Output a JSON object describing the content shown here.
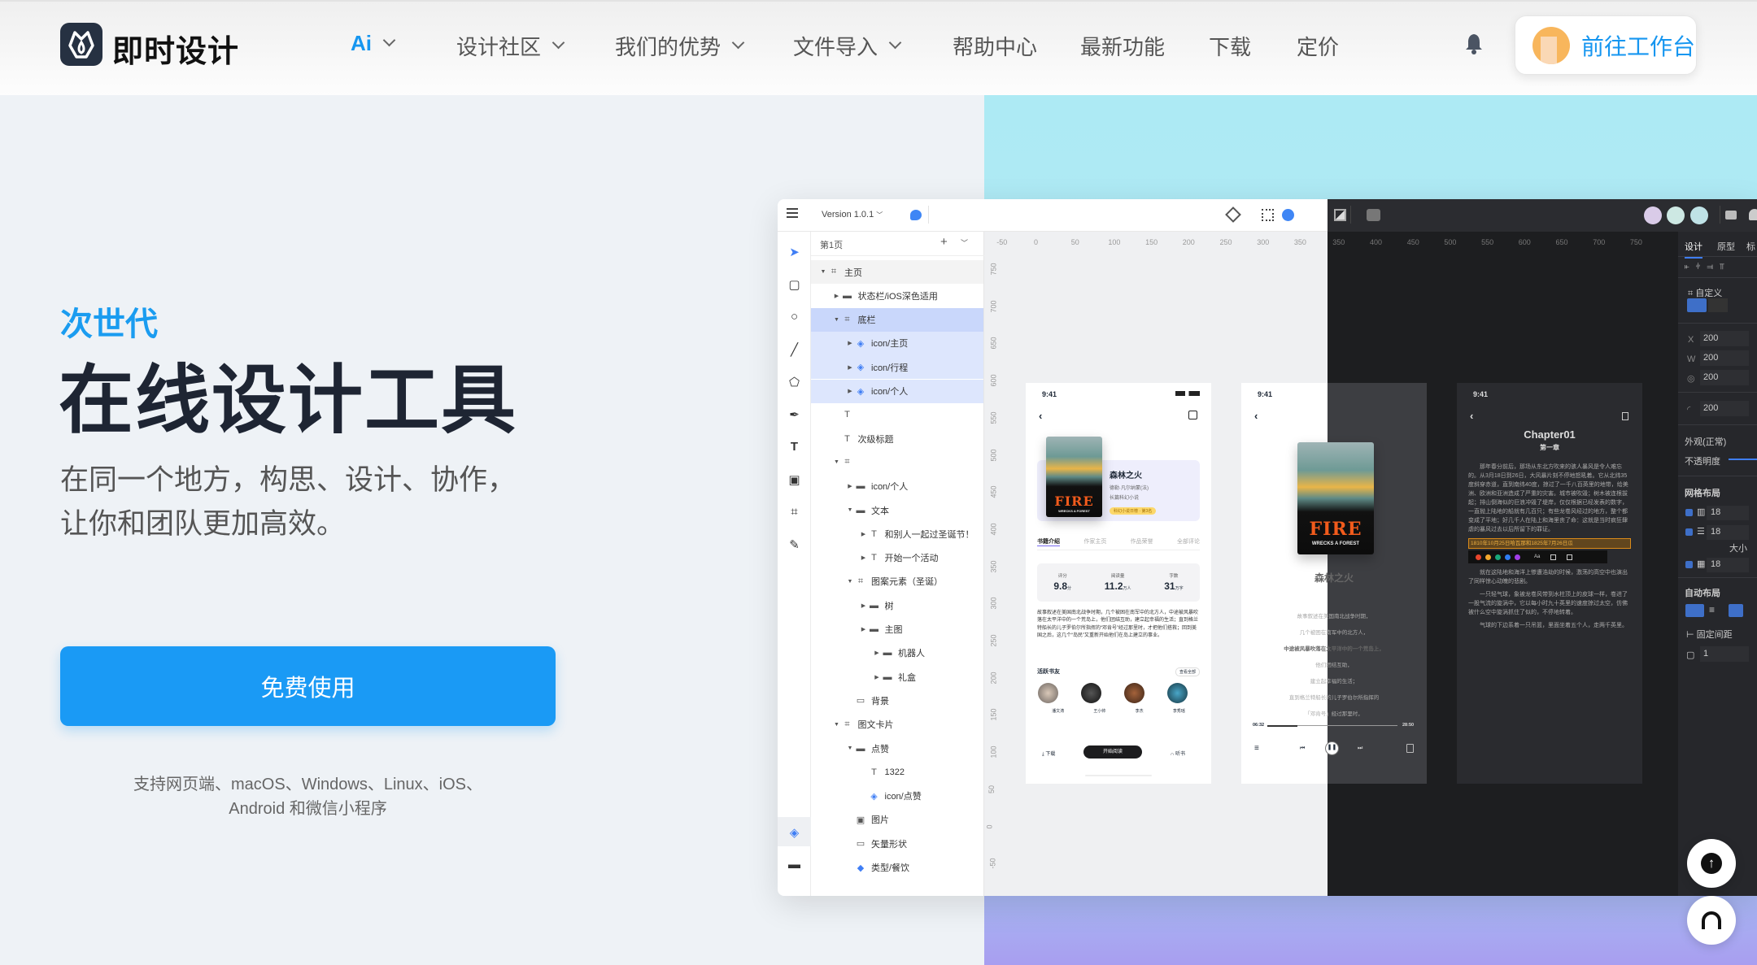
{
  "header": {
    "logo_text": "即时设计",
    "nav": [
      {
        "label": "Ai",
        "dropdown": true,
        "active": true
      },
      {
        "label": "设计社区",
        "dropdown": true
      },
      {
        "label": "我们的优势",
        "dropdown": true
      },
      {
        "label": "文件导入",
        "dropdown": true
      },
      {
        "label": "帮助中心",
        "dropdown": false
      },
      {
        "label": "最新功能",
        "dropdown": false
      },
      {
        "label": "下载",
        "dropdown": false
      },
      {
        "label": "定价",
        "dropdown": false
      }
    ],
    "bell_icon": "bell-icon",
    "workspace_button": "前往工作台"
  },
  "hero": {
    "kicker": "次世代",
    "title": "在线设计工具",
    "subtitle_lines": [
      "在同一个地方，构思、设计、协作，",
      "让你和团队更加高效。"
    ],
    "cta": "免费使用",
    "support_lines": [
      "支持网页端、macOS、Windows、Linux、iOS、",
      "Android 和微信小程序"
    ]
  },
  "colors": {
    "accent": "#1a9af5",
    "kicker": "#1a9cf0",
    "dark_canvas": "#1d1e20",
    "selected_layer": "#c9d7fb"
  },
  "app": {
    "version": "Version 1.0.1",
    "page": "第1页",
    "layers": [
      {
        "label": "主页",
        "type": "frame",
        "level": 0,
        "arrow": "down",
        "state": "hover"
      },
      {
        "label": "状态栏/iOS深色适用",
        "type": "folder",
        "level": 1,
        "arrow": "right"
      },
      {
        "label": "底栏",
        "type": "frame",
        "level": 1,
        "arrow": "down",
        "state": "selected"
      },
      {
        "label": "icon/主页",
        "type": "component",
        "level": 2,
        "arrow": "right",
        "state": "child"
      },
      {
        "label": "icon/行程",
        "type": "component",
        "level": 2,
        "arrow": "right",
        "state": "child"
      },
      {
        "label": "icon/个人",
        "type": "component",
        "level": 2,
        "arrow": "right",
        "state": "child"
      },
      {
        "label": "",
        "type": "text",
        "level": 1,
        "arrow": ""
      },
      {
        "label": "次级标题",
        "type": "text",
        "level": 1,
        "arrow": ""
      },
      {
        "label": "",
        "type": "frame",
        "level": 1,
        "arrow": "down"
      },
      {
        "label": "icon/个人",
        "type": "folder",
        "level": 2,
        "arrow": "right"
      },
      {
        "label": "文本",
        "type": "folder",
        "level": 2,
        "arrow": "down"
      },
      {
        "label": "和别人一起过圣诞节！",
        "type": "text",
        "level": 3,
        "arrow": "right"
      },
      {
        "label": "开始一个活动",
        "type": "text",
        "level": 3,
        "arrow": "right"
      },
      {
        "label": "图案元素（圣诞）",
        "type": "frame",
        "level": 2,
        "arrow": "down"
      },
      {
        "label": "树",
        "type": "folder",
        "level": 3,
        "arrow": "right"
      },
      {
        "label": "主图",
        "type": "folder",
        "level": 3,
        "arrow": "right"
      },
      {
        "label": "机器人",
        "type": "folder",
        "level": 4,
        "arrow": "right"
      },
      {
        "label": "礼盒",
        "type": "folder",
        "level": 4,
        "arrow": "right"
      },
      {
        "label": "背景",
        "type": "rect",
        "level": 2,
        "arrow": ""
      },
      {
        "label": "图文卡片",
        "type": "frame",
        "level": 1,
        "arrow": "down"
      },
      {
        "label": "点赞",
        "type": "folder",
        "level": 2,
        "arrow": "down"
      },
      {
        "label": "1322",
        "type": "text",
        "level": 3,
        "arrow": ""
      },
      {
        "label": "icon/点赞",
        "type": "component",
        "level": 3,
        "arrow": ""
      },
      {
        "label": "图片",
        "type": "image",
        "level": 2,
        "arrow": ""
      },
      {
        "label": "矢量形状",
        "type": "rect",
        "level": 2,
        "arrow": ""
      },
      {
        "label": "类型/餐饮",
        "type": "main-component",
        "level": 2,
        "arrow": ""
      }
    ],
    "ruler_top_light": [
      "-50",
      "0",
      "50",
      "100",
      "150",
      "200",
      "250",
      "300",
      "350"
    ],
    "ruler_top_dark": [
      "350",
      "400",
      "450",
      "500",
      "550",
      "600",
      "650",
      "700",
      "750"
    ],
    "ruler_left": [
      "750",
      "700",
      "650",
      "600",
      "550",
      "500",
      "450",
      "400",
      "350",
      "300",
      "250",
      "200",
      "150",
      "100",
      "50",
      "0",
      "-50"
    ],
    "phone1": {
      "time": "9:41",
      "book_title": "森林之火",
      "author": "德勒·凡尔纳蒙(法)",
      "genre": "长篇科幻小说",
      "badge": "科幻小说日榜 · 第3名",
      "cover_title": "FIRE",
      "cover_sub": "WRECKS A FOREST",
      "tabs": [
        "书籍介绍",
        "作家主页",
        "作品荣誉",
        "全部评论"
      ],
      "stats": [
        {
          "label": "评分",
          "value": "9.8",
          "unit": "分"
        },
        {
          "label": "阅读量",
          "value": "11.2",
          "unit": "万人"
        },
        {
          "label": "字数",
          "value": "31",
          "unit": "万字"
        }
      ],
      "description": "故事叙述在美国南北战争时期，几个被困在南军中的北方人，中途被风暴吹落在太平洋中的一个荒岛上，他们团结互助，建立起幸福的生活；直到格兰特船长的儿子罗伯尔所指挥的“邓肯号”经过那里时，才把他们搭救；回到美国之后，这几个“岛民”又重新开始他们在岛上建立的事业。",
      "friends_title": "活跃书友",
      "view_all": "查看全部",
      "friends": [
        "潘文涛",
        "王小帅",
        "李杰",
        "李秀瑶"
      ],
      "download": "下载",
      "start_reading": "开始阅读",
      "listen": "听书"
    },
    "phone2": {
      "time": "9:41",
      "book_title": "森林之火",
      "lyrics": [
        "故事叙述在美国南北战争时期，",
        "几个被困在南军中的北方人，",
        "中途被风暴吹落在太平洋中的一个荒岛上，",
        "他们团结互助，",
        "建立起幸福的生活；",
        "直到格兰特船长的儿子罗伯尔所指挥的",
        "「邓肯号」经过那里时，"
      ],
      "current_lyric_index": 2,
      "elapsed": "06:32",
      "total": "28:50",
      "progress": 0.23
    },
    "phone3": {
      "time": "9:41",
      "chapter": "Chapter01",
      "chapter_cn": "第一章",
      "paragraphs": [
        "那年春分前后，那场从东北方吹来的骇人暴风是令人难忘的。从3月18日到26日，大风暴片刻不停地怒吼着。它从北纬35度斜穿赤道，直到南纬40度，掠过了一千八百英里的地带，给美洲、欧洲和亚洲造成了严重的灾害。城市被吹毁；树木被连根拔起；排山倒海似的巨浪冲毁了堤岸，仅仅根据已经发表的数字，一直抛上陆地的船就有几百只；有些龙卷风经过的地方，整个都变成了平地；好几千人在陆上和海里丧了命：这就是当时疯狂肆虐的暴风过去以后所留下的罪证。",
        "就在这陆地和海洋上惨遭浩劫的时候，激荡的高空中也演出了同样惊心动魄的悲剧。",
        "一只轻气球，象被龙卷风带到水柱顶上的皮球一样，卷进了一股气流的旋涡中，它以每小时九十英里的速度掠过太空，仿佛被什么空中旋涡抓住了似的，不停地转着。",
        "气球的下边系着一只吊篮，里面坐着五个人，走两千英里。"
      ],
      "highlight": "1810年10月25日哈瓦那和1825年7月26日瓜",
      "highlight_colors": [
        "#e8452c",
        "#f2a72c",
        "#18a87a",
        "#2f7df2",
        "#a23ee8"
      ],
      "font_label": "Aa"
    },
    "right_panel": {
      "tabs": [
        "设计",
        "原型",
        "标"
      ],
      "preset": "自定义",
      "x_label": "X",
      "x": "200",
      "w_label": "W",
      "w": "200",
      "rotation": "200",
      "radius": "200",
      "appearance": "外观(正常)",
      "opacity_label": "不透明度",
      "opacity": 0.6,
      "grid_title": "网格布局",
      "grids": [
        {
          "checked": true,
          "value": "18"
        },
        {
          "checked": true,
          "value": "18"
        },
        {
          "checked": true,
          "value": "18"
        }
      ],
      "size_label": "大小",
      "auto_layout": "自动布局",
      "spacing_label": "固定间距",
      "spacing": "1"
    }
  }
}
